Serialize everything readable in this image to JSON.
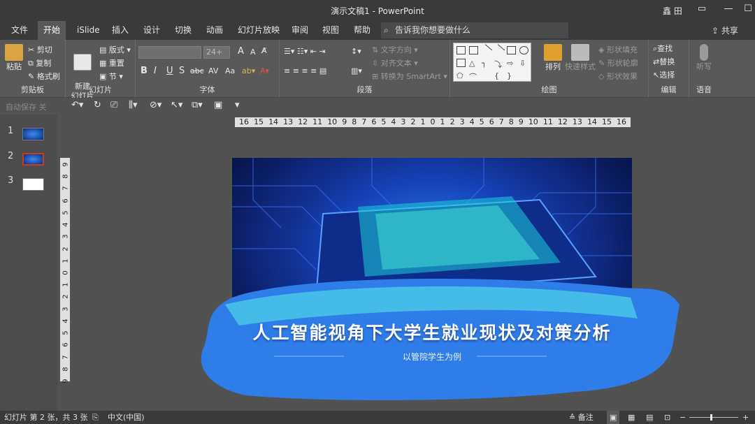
{
  "window": {
    "title": "演示文稿1  -  PowerPoint",
    "user": "鑫 田"
  },
  "menu": {
    "tabs": [
      "文件",
      "开始",
      "iSlide",
      "插入",
      "设计",
      "切换",
      "动画",
      "幻灯片放映",
      "审阅",
      "视图",
      "帮助"
    ],
    "active_tab": "开始",
    "tell_me": "告诉我你想要做什么",
    "share": "共享"
  },
  "ribbon": {
    "clipboard": {
      "label": "剪贴板",
      "paste": "粘贴",
      "cut": "剪切",
      "copy": "复制",
      "format_painter": "格式刷"
    },
    "slides": {
      "label": "幻灯片",
      "new_slide": "新建\n幻灯片",
      "layout": "版式",
      "reset": "重置",
      "section": "节"
    },
    "font": {
      "label": "字体",
      "size": "24+",
      "bold": "B",
      "italic": "I",
      "underline": "U",
      "shadow": "S",
      "strike": "abc",
      "spacing": "AV",
      "case": "Aa",
      "grow": "A",
      "shrink": "A"
    },
    "paragraph": {
      "label": "段落",
      "text_direction": "文字方向",
      "align_text": "对齐文本",
      "smartart": "转换为 SmartArt"
    },
    "drawing": {
      "label": "绘图",
      "arrange": "排列",
      "quick_styles": "快速样式",
      "fill": "形状填充",
      "outline": "形状轮廓",
      "effects": "形状效果"
    },
    "editing": {
      "label": "编辑",
      "find": "查找",
      "replace": "替换",
      "select": "选择"
    },
    "voice": {
      "label": "语音",
      "dictate": "听写"
    }
  },
  "qat": {
    "autosave": "自动保存",
    "toggle": "关"
  },
  "ruler": {
    "h": [
      "16",
      "15",
      "14",
      "13",
      "12",
      "11",
      "10",
      "9",
      "8",
      "7",
      "6",
      "5",
      "4",
      "3",
      "2",
      "1",
      "0",
      "1",
      "2",
      "3",
      "4",
      "5",
      "6",
      "7",
      "8",
      "9",
      "10",
      "11",
      "12",
      "13",
      "14",
      "15",
      "16"
    ],
    "v": [
      "9",
      "8",
      "7",
      "6",
      "5",
      "4",
      "3",
      "2",
      "1",
      "0",
      "1",
      "2",
      "3",
      "4",
      "5",
      "6",
      "7",
      "8",
      "9"
    ]
  },
  "thumbnails": [
    "1",
    "2",
    "3"
  ],
  "slide": {
    "title": "人工智能视角下大学生就业现状及对策分析",
    "subtitle": "以管院学生为例"
  },
  "status": {
    "slide_info": "幻灯片 第 2 张，共 3 张",
    "language": "中文(中国)",
    "notes": "备注"
  },
  "colors": {
    "accent": "#c43e1c",
    "banner": "#2f7de8",
    "ribbon": "#595959"
  }
}
